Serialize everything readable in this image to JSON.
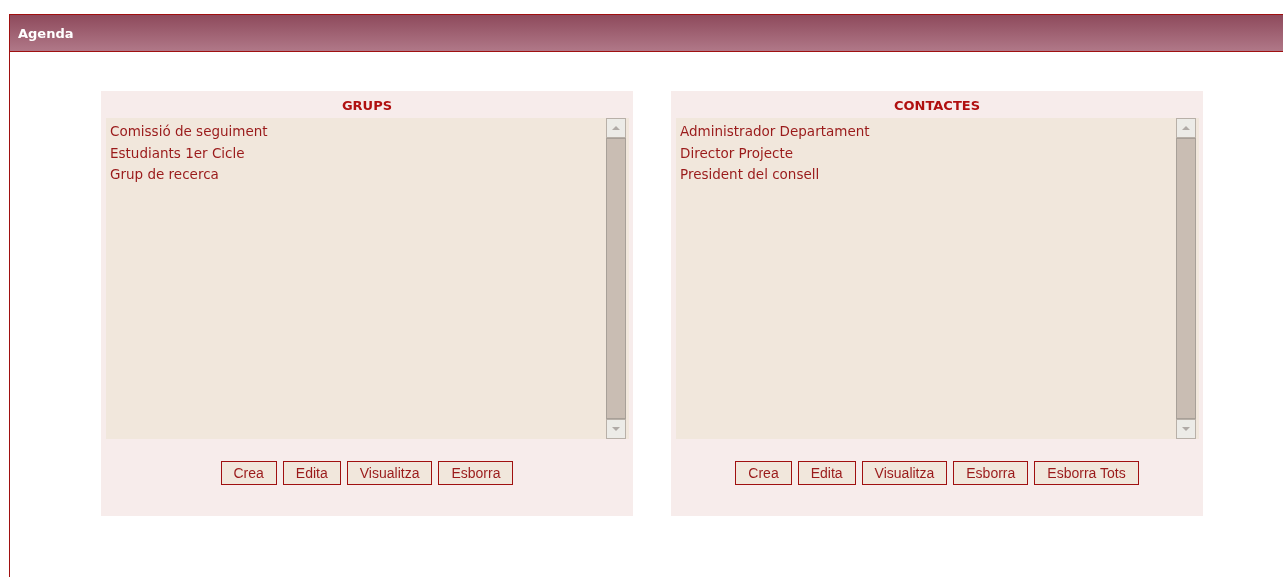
{
  "window": {
    "title": "Agenda"
  },
  "panels": [
    {
      "title": "GRUPS",
      "items": [
        "Comissió de seguiment",
        "Estudiants 1er Cicle",
        "Grup de recerca"
      ],
      "buttons": [
        "Crea",
        "Edita",
        "Visualitza",
        "Esborra"
      ]
    },
    {
      "title": "CONTACTES",
      "items": [
        "Administrador Departament",
        "Director Projecte",
        "President del consell"
      ],
      "buttons": [
        "Crea",
        "Edita",
        "Visualitza",
        "Esborra",
        "Esborra Tots"
      ]
    }
  ]
}
